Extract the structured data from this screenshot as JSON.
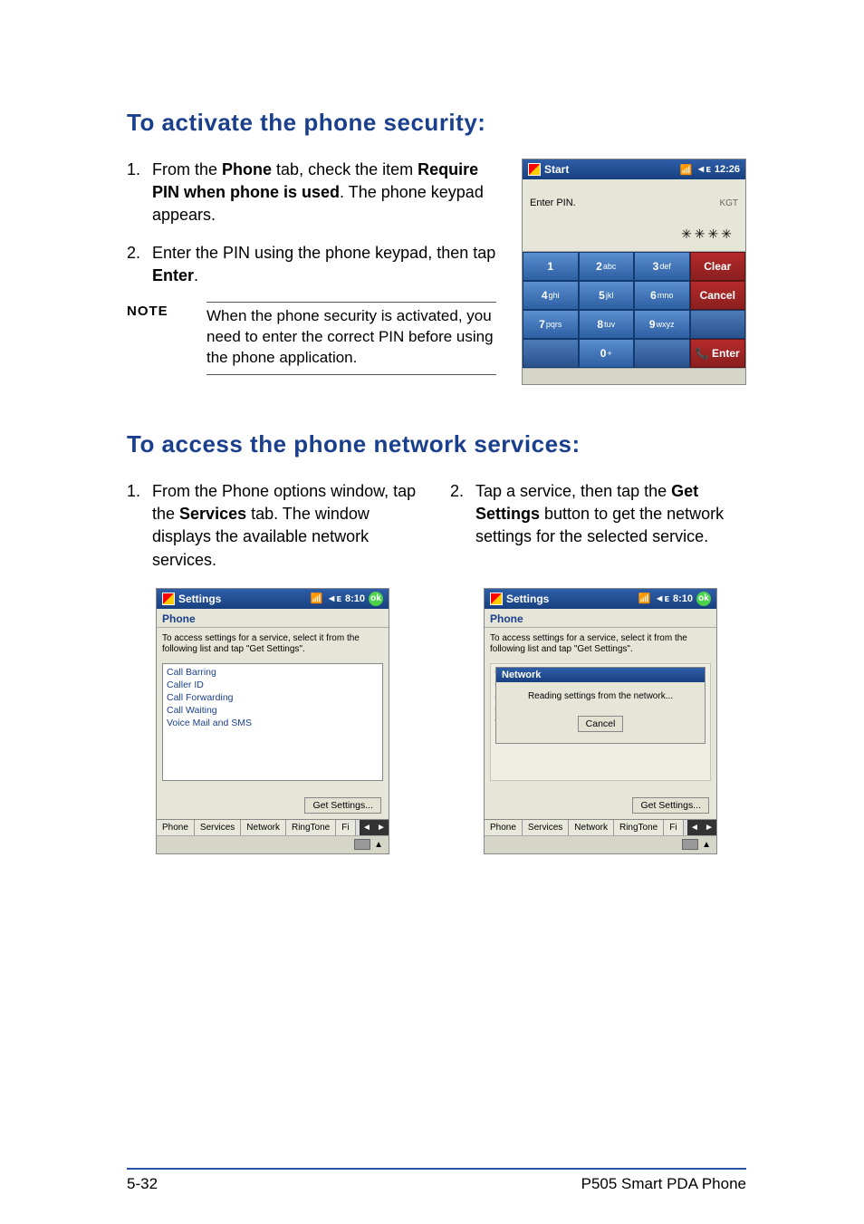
{
  "section1": {
    "heading": "To activate the phone security:",
    "steps": [
      {
        "num": "1.",
        "pre": "From the ",
        "b1": "Phone",
        "mid1": " tab, check the item ",
        "b2": "Require PIN when phone is used",
        "post": ". The phone keypad appears."
      },
      {
        "num": "2.",
        "pre": "Enter the PIN using the phone keypad, then tap ",
        "b1": "Enter",
        "post": "."
      }
    ],
    "note_label": "NOTE",
    "note_body": "When the phone security is activated, you need to enter the correct PIN before using the phone application."
  },
  "pin_screen": {
    "start": "Start",
    "signal_icon_text": "📶",
    "volume_icon_text": "◄ᴇ",
    "time": "12:26",
    "prompt": "Enter PIN.",
    "operator": "KGT",
    "display": "✳✳✳✳",
    "keys": [
      [
        {
          "d": "1",
          "s": ""
        },
        {
          "d": "2",
          "s": "abc"
        },
        {
          "d": "3",
          "s": "def"
        },
        {
          "d": "Clear",
          "s": "",
          "action": true
        }
      ],
      [
        {
          "d": "4",
          "s": "ghi"
        },
        {
          "d": "5",
          "s": "jkl"
        },
        {
          "d": "6",
          "s": "mno"
        },
        {
          "d": "Cancel",
          "s": "",
          "action": true
        }
      ],
      [
        {
          "d": "7",
          "s": "pqrs"
        },
        {
          "d": "8",
          "s": "tuv"
        },
        {
          "d": "9",
          "s": "wxyz"
        },
        {
          "d": "",
          "s": "",
          "empty": true
        }
      ],
      [
        {
          "d": "",
          "s": "",
          "empty": true
        },
        {
          "d": "0",
          "s": "+"
        },
        {
          "d": "",
          "s": "",
          "empty": true
        },
        {
          "d": "📞 Enter",
          "s": "",
          "action": true
        }
      ]
    ]
  },
  "section2": {
    "heading": "To access the phone network services:",
    "step1": {
      "num": "1.",
      "pre": "From the Phone options window, tap the ",
      "b": "Services",
      "post": " tab. The window displays the available network services."
    },
    "step2": {
      "num": "2.",
      "pre": "Tap a service, then tap the ",
      "b": "Get Settings",
      "post": " button to get the network settings for the selected service."
    }
  },
  "settings_screen": {
    "title": "Settings",
    "time": "8:10",
    "ok": "ok",
    "header": "Phone",
    "instr": "To access settings for a service, select it from the following list and tap \"Get Settings\".",
    "services": [
      "Call Barring",
      "Caller ID",
      "Call Forwarding",
      "Call Waiting",
      "Voice Mail and SMS"
    ],
    "get_btn": "Get Settings...",
    "tabs": [
      "Phone",
      "Services",
      "Network",
      "RingTone",
      "Fi"
    ]
  },
  "network_popup": {
    "title": "Network",
    "body": "Reading settings from the network...",
    "cancel": "Cancel"
  },
  "footer": {
    "left": "5-32",
    "right": "P505 Smart PDA Phone"
  }
}
